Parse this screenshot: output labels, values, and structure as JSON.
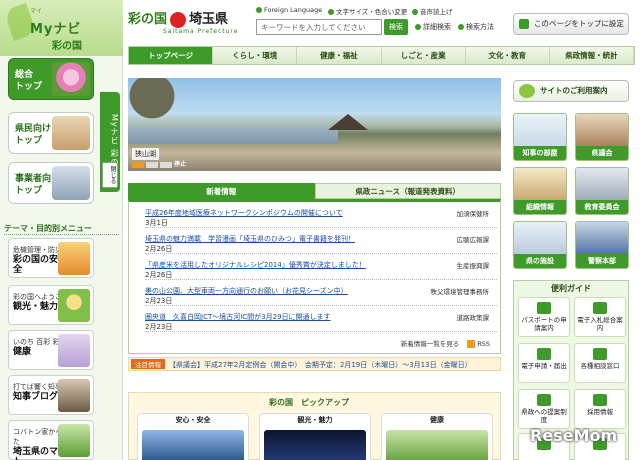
{
  "left": {
    "mynavi_small": "マイ",
    "mynavi_title": "Myナビ",
    "mynavi_sub": "彩の国",
    "nav": [
      {
        "label": "総合\nトップ"
      },
      {
        "label": "県民向け\nトップ"
      },
      {
        "label": "事業者向け\nトップ"
      }
    ],
    "vertical_tab": "Myナビ 彩の国",
    "vertical_close": "閉じる",
    "theme_heading": "テーマ・目的別メニュー",
    "themes": [
      {
        "small": "危機管理・防災・防犯等",
        "big": "彩の国の安心・安全"
      },
      {
        "small": "彩の国へようこそ",
        "big": "観光・魅力"
      },
      {
        "small": "いのち 百彩 彩の国",
        "big": "健康"
      },
      {
        "small": "打てば響く知事の太鼓",
        "big": "知事ブログ"
      },
      {
        "small": "コバトン家からやってきた",
        "big": "埼玉県のマスコット"
      }
    ]
  },
  "header": {
    "logo_left": "彩の国",
    "logo_right": "埼玉県",
    "logo_sub": "Saitama Prefecture",
    "foreign": "Foreign Language",
    "fontsize": "文字サイズ・色合い変更",
    "voice": "音声読上げ",
    "search_placeholder": "キーワードを入力してください",
    "search_button": "検索",
    "advanced": "詳細検索",
    "method": "検索方法",
    "set_top": "このページをトップに設定"
  },
  "nav": [
    "トップページ",
    "くらし・環境",
    "健康・福祉",
    "しごと・産業",
    "文化・教育",
    "県政情報・統計"
  ],
  "hero": {
    "caption": "狭山湖",
    "stop": "停止"
  },
  "news": {
    "tab_new": "新着情報",
    "tab_press": "県政ニュース（報道発表資料）",
    "items": [
      {
        "title": "平成26年度地域医療ネットワークシンポジウムの開催について",
        "date": "3月1日",
        "dept": "加須保健所"
      },
      {
        "title": "埼玉県の魅力満載　学習漫画「埼玉県のひみつ」電子書籍を発刊！",
        "date": "2月26日",
        "dept": "広聴広報課"
      },
      {
        "title": "「県産米を活用したオリジナルレシピ2014」優秀賞が決定しました！",
        "date": "2月26日",
        "dept": "生産振興課"
      },
      {
        "title": "美の山公園、大型車両一方向通行のお願い（お花見シーズン中）",
        "date": "2月23日",
        "dept": "秩父環境管理事務所"
      },
      {
        "title": "圏央道　久喜白岡JCT〜境古河IC間が3月29日に開通します",
        "date": "2月23日",
        "dept": "道路政策課"
      }
    ],
    "more": "新着情報一覧を見る",
    "rss": "RSS"
  },
  "notice": {
    "badge": "注目情報",
    "text": "【県議会】平成27年2月定例会（開会中）　会期予定：2月19日（木曜日）〜3月13日（金曜日）"
  },
  "pickup": {
    "heading": "彩の国　ピックアップ",
    "cards": [
      "安心・安全",
      "観光・魅力",
      "健康"
    ]
  },
  "right": {
    "user_guide": "サイトのご利用案内",
    "tiles": [
      "知事の部屋",
      "県議会",
      "組織情報",
      "教育委員会",
      "県の施設",
      "警察本部"
    ],
    "guide_heading": "便利ガイド",
    "guide_items": [
      "パスポートの申請案内",
      "電子入札総合案内",
      "電子申請・届出",
      "各種相談窓口",
      "県政への提案制度",
      "採用情報",
      "",
      ""
    ]
  },
  "watermark": "ReseMom",
  "colors": {
    "brand_green": "#3e9b2a",
    "link_blue": "#1a4fa0",
    "notice_orange": "#e36a1b"
  }
}
